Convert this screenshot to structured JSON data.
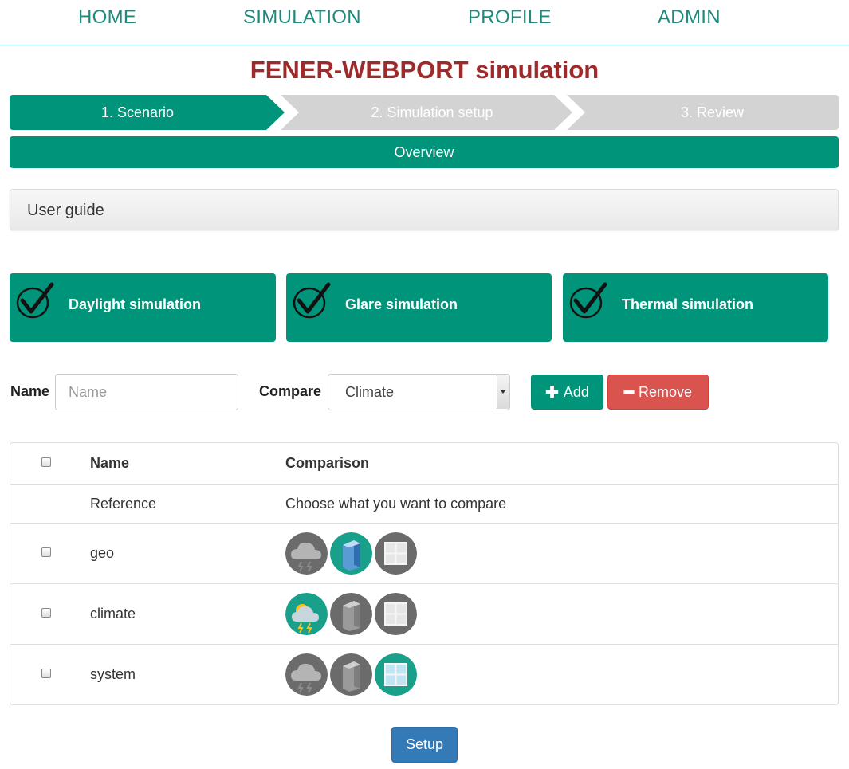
{
  "nav": {
    "home": "HOME",
    "simulation": "SIMULATION",
    "profile": "PROFILE",
    "admin": "ADMIN"
  },
  "page_title": "FENER-WEBPORT simulation",
  "wizard": {
    "steps": [
      {
        "label": "1. Scenario",
        "active": true
      },
      {
        "label": "2. Simulation setup",
        "active": false
      },
      {
        "label": "3. Review",
        "active": false
      }
    ],
    "overview": "Overview"
  },
  "user_guide": "User guide",
  "sim_types": [
    {
      "label": "Daylight simulation",
      "checked": true
    },
    {
      "label": "Glare simulation",
      "checked": true
    },
    {
      "label": "Thermal simulation",
      "checked": true
    }
  ],
  "form": {
    "name_label": "Name",
    "name_placeholder": "Name",
    "name_value": "",
    "compare_label": "Compare",
    "compare_selected": "Climate",
    "add_label": "Add",
    "remove_label": "Remove"
  },
  "table": {
    "headers": {
      "name": "Name",
      "comparison": "Comparison"
    },
    "reference": {
      "name": "Reference",
      "comparison": "Choose what you want to compare"
    },
    "rows": [
      {
        "name": "geo",
        "checked": false,
        "icons": [
          {
            "name": "climate-icon",
            "active": false
          },
          {
            "name": "building-icon",
            "active": true
          },
          {
            "name": "window-icon",
            "active": false
          }
        ]
      },
      {
        "name": "climate",
        "checked": false,
        "icons": [
          {
            "name": "climate-icon",
            "active": true
          },
          {
            "name": "building-icon",
            "active": false
          },
          {
            "name": "window-icon",
            "active": false
          }
        ]
      },
      {
        "name": "system",
        "checked": false,
        "icons": [
          {
            "name": "climate-icon",
            "active": false
          },
          {
            "name": "building-icon",
            "active": false
          },
          {
            "name": "window-icon",
            "active": true
          }
        ]
      }
    ]
  },
  "setup_label": "Setup",
  "colors": {
    "brand": "#00957a",
    "title": "#9e2b2b",
    "danger": "#d9534f",
    "primary": "#337ab7",
    "step_inactive": "#d3d3d3"
  }
}
